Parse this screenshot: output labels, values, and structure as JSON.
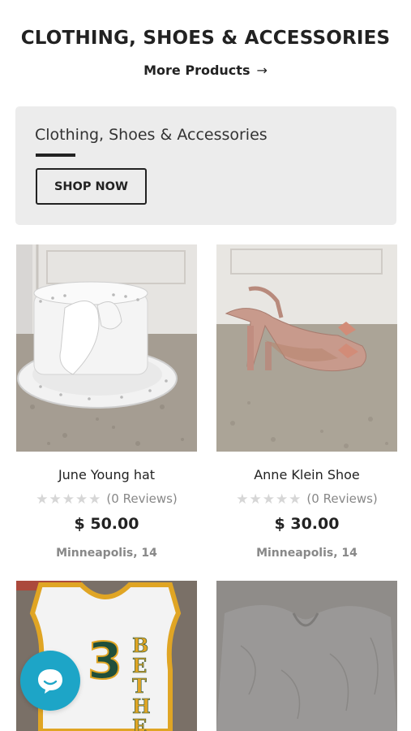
{
  "section": {
    "title": "CLOTHING, SHOES & ACCESSORIES",
    "more_link": "More Products",
    "more_icon": "arrow-right-icon"
  },
  "banner": {
    "title": "Clothing, Shoes & Accessories",
    "button": "SHOP NOW"
  },
  "products": [
    {
      "name": "June Young hat",
      "stars": "★★★★★",
      "reviews": "(0 Reviews)",
      "price": "$ 50.00",
      "location": "Minneapolis, 14",
      "rating": 0
    },
    {
      "name": "Anne Klein Shoe",
      "stars": "★★★★★",
      "reviews": "(0 Reviews)",
      "price": "$ 30.00",
      "location": "Minneapolis, 14",
      "rating": 0
    }
  ],
  "jersey": {
    "number": "3",
    "letters": [
      "B",
      "E",
      "T",
      "H",
      "E"
    ]
  },
  "colors": {
    "accent": "#1da5c7",
    "banner_bg": "#ececec",
    "text": "#222222",
    "muted": "#888888",
    "star_empty": "#d6d6d6"
  },
  "chat": {
    "icon": "chat-bubble-icon"
  }
}
